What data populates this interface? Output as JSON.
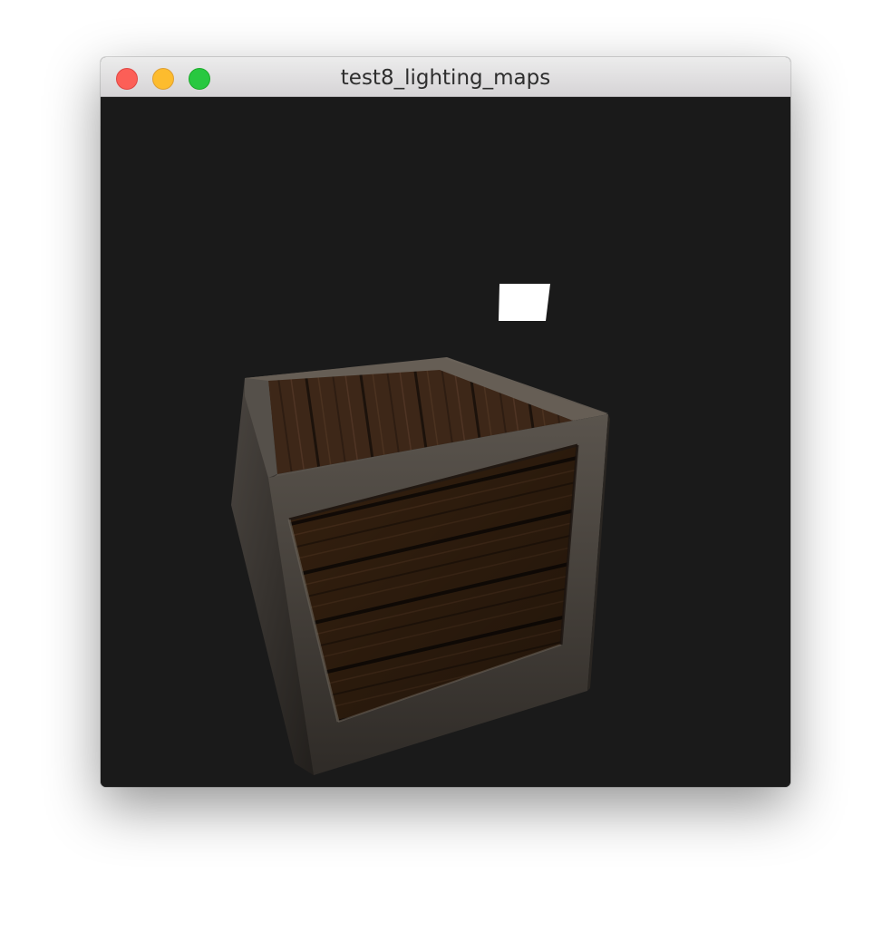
{
  "window": {
    "title": "test8_lighting_maps",
    "controls": {
      "close": "close-button",
      "minimize": "minimize-button",
      "zoom": "zoom-button"
    }
  },
  "scene": {
    "background_color": "#1a1a1a",
    "light_color": "#ffffff",
    "objects": [
      "light-cube",
      "wooden-crate"
    ]
  }
}
